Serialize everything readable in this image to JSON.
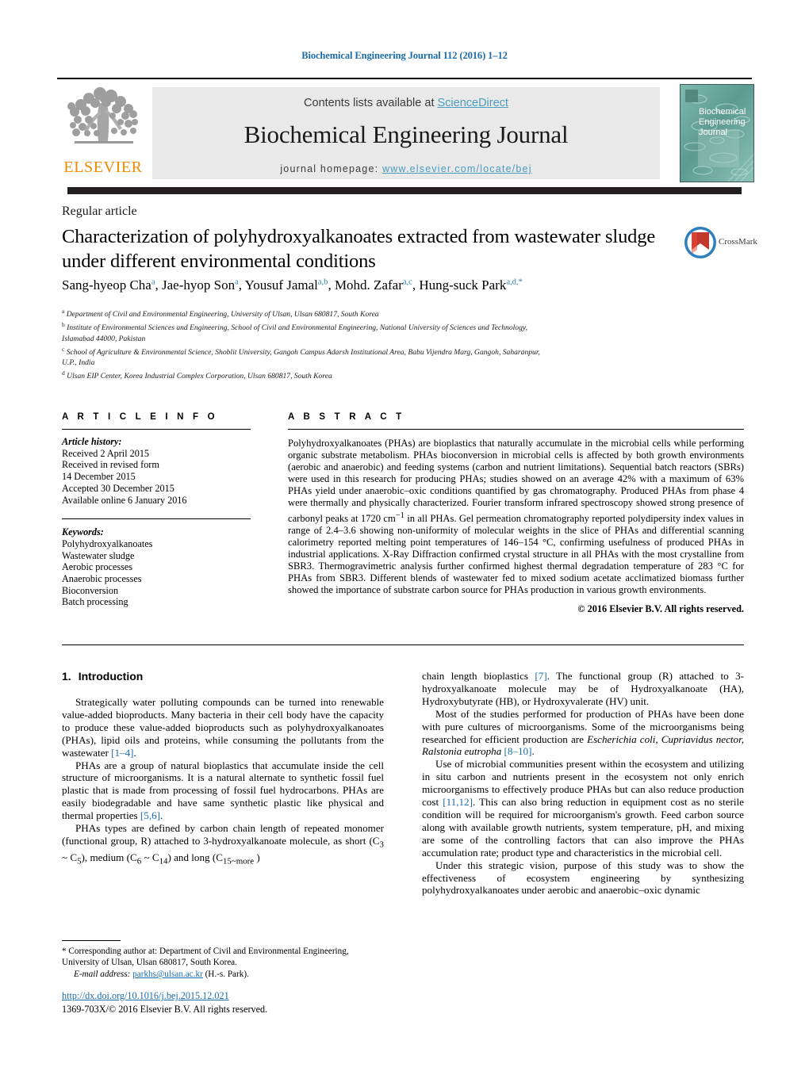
{
  "running_head": "Biochemical Engineering Journal 112 (2016) 1–12",
  "masthead": {
    "contents_prefix": "Contents lists available at ",
    "contents_link": "ScienceDirect",
    "journal_name": "Biochemical Engineering Journal",
    "homepage_prefix": "journal homepage: ",
    "homepage_url": "www.elsevier.com/locate/bej",
    "publisher_wordmark": "ELSEVIER",
    "cover_title_lines": [
      "Biochemical",
      "Engineering",
      "Journal"
    ]
  },
  "article": {
    "type_label": "Regular article",
    "title": "Characterization of polyhydroxyalkanoates extracted from wastewater sludge under different environmental conditions",
    "crossmark_label": "CrossMark",
    "authors_html": "Sang-hyeop Cha<sup>a</sup>, Jae-hyop Son<sup>a</sup>, Yousuf Jamal<sup>a,b</sup>, Mohd. Zafar<sup>a,c</sup>, Hung-suck Park<sup>a,d,</sup><sup>*</sup>",
    "affiliations_html": "<sup>a</sup> Department of Civil and Environmental Engineering, University of Ulsan, Ulsan 680817, South Korea<br><sup>b</sup> Institute of Environmental Sciences and Engineering, School of Civil and Environmental Engineering, National University of Sciences and Technology,<br>Islamabad 44000, Pakistan<br><sup>c</sup> School of Agriculture &amp; Environmental Science, Shoblit University, Gangoh Campus Adarsh Institutional Area, Babu Vijendra Marg, Gangoh, Saharanpur,<br>U.P., India<br><sup>d</sup> Ulsan EIP Center, Korea Industrial Complex Corporation, Ulsan 680817, South Korea"
  },
  "article_info": {
    "heading": "A R T I C L E  I N F O",
    "history_label": "Article history:",
    "history_lines": [
      "Received 2 April 2015",
      "Received in revised form",
      "14 December 2015",
      "Accepted 30 December 2015",
      "Available online 6 January 2016"
    ],
    "keywords_label": "Keywords:",
    "keywords": [
      "Polyhydroxyalkanoates",
      "Wastewater sludge",
      "Aerobic processes",
      "Anaerobic processes",
      "Bioconversion",
      "Batch processing"
    ]
  },
  "abstract": {
    "heading": "A B S T R A C T",
    "body_html": "Polyhydroxyalkanoates (PHAs) are bioplastics that naturally accumulate in the microbial cells while performing organic substrate metabolism. PHAs bioconversion in microbial cells is affected by both growth environments (aerobic and anaerobic) and feeding systems (carbon and nutrient limitations). Sequential batch reactors (SBRs) were used in this research for producing PHAs; studies showed on an average 42% with a maximum of 63% PHAs yield under anaerobic–oxic conditions quantified by gas chromatography. Produced PHAs from phase 4 were thermally and physically characterized. Fourier transform infrared spectroscopy showed strong presence of carbonyl peaks at 1720 cm<sup>−1</sup> in all PHAs. Gel permeation chromatography reported polydipersity index values in range of 2.4–3.6 showing non-uniformity of molecular weights in the slice of PHAs and differential scanning calorimetry reported melting point temperatures of 146–154 °C, confirming usefulness of produced PHAs in industrial applications. X-Ray Diffraction confirmed crystal structure in all PHAs with the most crystalline from SBR3. Thermogravimetric analysis further confirmed highest thermal degradation temperature of 283 °C for PHAs from SBR3. Different blends of wastewater fed to mixed sodium acetate acclimatized biomass further showed the importance of substrate carbon source for PHAs production in various growth environments.",
    "copyright": "© 2016 Elsevier B.V. All rights reserved."
  },
  "introduction": {
    "number": "1.",
    "heading": "Introduction",
    "left_paragraphs_html": [
      "Strategically water polluting compounds can be turned into renewable value-added bioproducts. Many bacteria in their cell body have the capacity to produce these value-added bioproducts such as polyhydroxyalkanoates (PHAs), lipid oils and proteins, while consuming the pollutants from the wastewater <span class=\"ref\">[1–4]</span>.",
      "PHAs are a group of natural bioplastics that accumulate inside the cell structure of microorganisms. It is a natural alternate to synthetic fossil fuel plastic that is made from processing of fossil fuel hydrocarbons. PHAs are easily biodegradable and have same synthetic plastic like physical and thermal properties <span class=\"ref\">[5,6]</span>.",
      "PHAs types are defined by carbon chain length of repeated monomer (functional group, R) attached to 3-hydroxyalkanoate molecule, as short (C<sub>3</sub> ~ C<sub>5</sub>), medium (C<sub>6</sub> ~ C<sub>14</sub>) and long (C<sub>15~more</sub> )"
    ],
    "right_paragraphs_html": [
      "chain length bioplastics <span class=\"ref\">[7]</span>. The functional group (R) attached to 3-hydroxyalkanoate molecule may be of Hydroxyalkanoate (HA), Hydroxybutyrate (HB), or Hydroxyvalerate (HV) unit.",
      "Most of the studies performed for production of PHAs have been done with pure cultures of microorganisms. Some of the microorganisms being researched for efficient production are <span class=\"ital\">Escherichia coli, Cupriavidus nector, Ralstonia eutropha</span> <span class=\"ref\">[8–10]</span>.",
      "Use of microbial communities present within the ecosystem and utilizing in situ carbon and nutrients present in the ecosystem not only enrich microorganisms to effectively produce PHAs but can also reduce production cost <span class=\"ref\">[11,12]</span>. This can also bring reduction in equipment cost as no sterile condition will be required for microorganism's growth. Feed carbon source along with available growth nutrients, system temperature, pH, and mixing are some of the controlling factors that can also improve the PHAs accumulation rate; product type and characteristics in the microbial cell.",
      "Under this strategic vision, purpose of this study was to show the effectiveness of ecosystem engineering by synthesizing polyhydroxyalkanoates under aerobic and anaerobic–oxic dynamic"
    ]
  },
  "footer": {
    "corresponding_html": "<span class=\"star\">*</span> Corresponding author at: Department of Civil and Environmental Engineering, University of Ulsan, Ulsan 680817, South Korea.",
    "email_label": "E-mail address:",
    "email": "parkhs@ulsan.ac.kr",
    "email_suffix": "(H.-s. Park).",
    "doi_url": "http://dx.doi.org/10.1016/j.bej.2015.12.021",
    "issn_copyright": "1369-703X/© 2016 Elsevier B.V. All rights reserved."
  },
  "colors": {
    "link_blue": "#1b6ca8",
    "sciencedirect_blue": "#4a9cc0",
    "elsevier_orange": "#f08a00",
    "masthead_grey": "#e9e9e9",
    "rule_black": "#231f20",
    "cover_teal": "#6fa8a0"
  }
}
